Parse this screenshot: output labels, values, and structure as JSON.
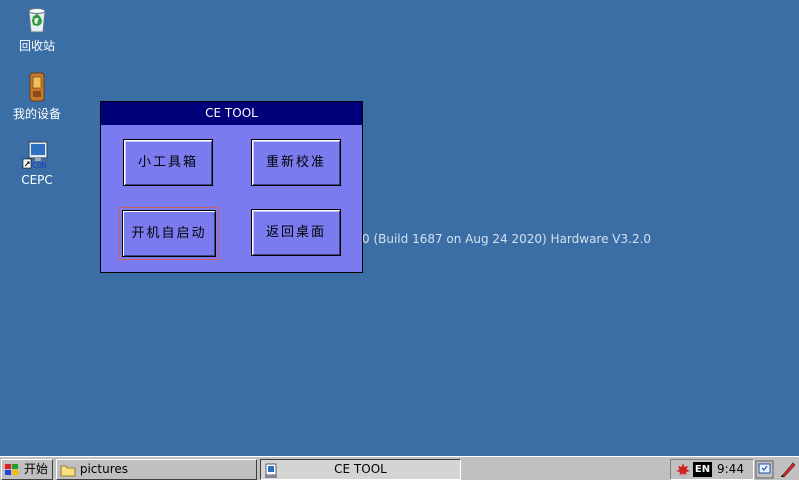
{
  "desktop": {
    "icons": [
      {
        "label": "回收站",
        "icon": "recycle-bin-icon"
      },
      {
        "label": "我的设备",
        "icon": "device-icon"
      },
      {
        "label": "CEPC",
        "icon": "cepc-shortcut-icon"
      }
    ],
    "background_text": "0 (Build 1687 on Aug 24 2020) Hardware V3.2.0",
    "background_color": "#3a6ea5"
  },
  "ce_tool": {
    "title": "CE TOOL",
    "buttons": {
      "toolbox": "小工具箱",
      "recalibrate": "重新校准",
      "autostart": "开机自启动",
      "desktop": "返回桌面"
    },
    "titlebar_color": "#00007b",
    "body_color": "#7b7bf0"
  },
  "taskbar": {
    "start_label": "开始",
    "tasks": [
      {
        "label": "pictures",
        "icon": "folder-icon"
      },
      {
        "label": "CE TOOL",
        "icon": "app-icon"
      }
    ],
    "tray": {
      "lang": "EN",
      "time": "9:44"
    }
  }
}
